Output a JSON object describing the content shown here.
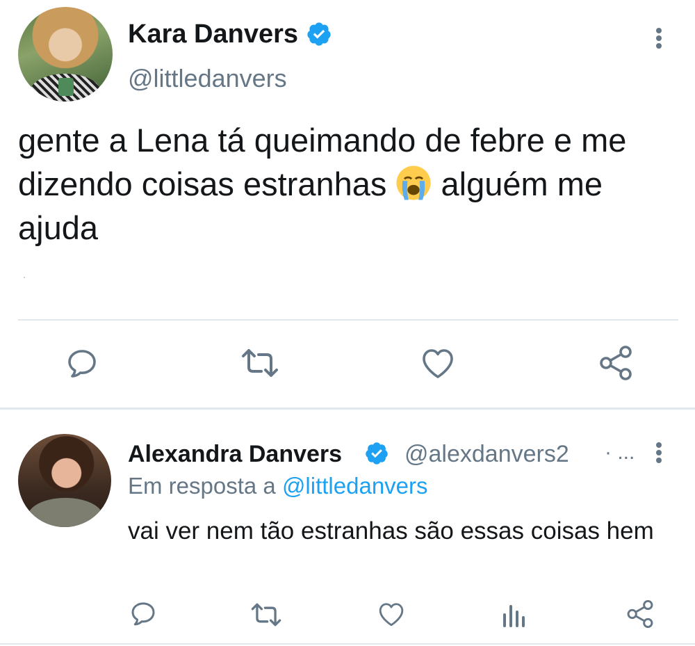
{
  "main_tweet": {
    "author_name": "Kara Danvers",
    "handle": "@littledanvers",
    "text_before_emoji": "gente a Lena tá queimando de febre e me dizendo coisas estranhas",
    "emoji": "loudly-crying-face",
    "text_after_emoji": "alguém me ajuda",
    "actions": [
      "reply",
      "retweet",
      "like",
      "share"
    ]
  },
  "reply_tweet": {
    "author_name": "Alexandra Danvers",
    "handle": "@alexdanvers2",
    "handle_suffix": "· ...",
    "reply_prefix": "Em resposta a",
    "reply_mention": "@littledanvers",
    "text": "vai ver nem tão estranhas são essas coisas hem",
    "actions": [
      "reply",
      "retweet",
      "like",
      "analytics",
      "share"
    ]
  },
  "colors": {
    "verified_blue": "#1da1f2",
    "secondary_gray": "#657786",
    "text_dark": "#14171a",
    "divider": "#e1e8ed"
  },
  "icons": {
    "verified": "verified-badge-icon",
    "more": "more-vertical-icon",
    "reply": "reply-bubble-icon",
    "retweet": "retweet-icon",
    "like": "heart-icon",
    "share": "share-icon",
    "analytics": "analytics-icon"
  }
}
